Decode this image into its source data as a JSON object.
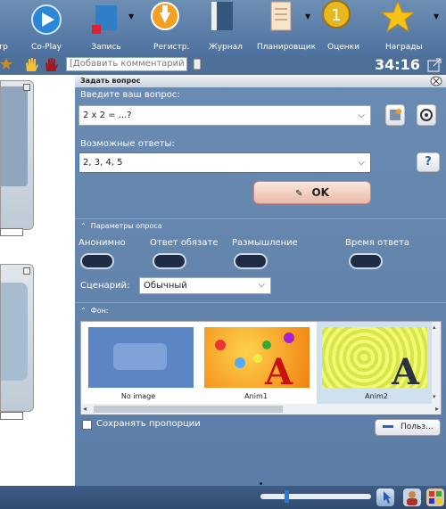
{
  "toolbar": {
    "items": [
      {
        "label": "нтр"
      },
      {
        "label": "Co-Play"
      },
      {
        "label": "Запись"
      },
      {
        "label": "Регистр."
      },
      {
        "label": "Журнал"
      },
      {
        "label": "Планировщик"
      },
      {
        "label": "Оценки"
      },
      {
        "label": "Награды"
      }
    ]
  },
  "controls": {
    "comment_placeholder": "[Добавить комментарий в жу",
    "timer": "34:16"
  },
  "dialog": {
    "title": "Задать вопрос",
    "question_label": "Введите ваш вопрос:",
    "question_value": "2 x 2 = ...?",
    "answers_label": "Возможные ответы:",
    "answers_value": "2, 3, 4, 5",
    "ok_label": "OK",
    "help_label": "?",
    "params_header": "Параметры опроса",
    "toggles": [
      {
        "label": "Анонимно"
      },
      {
        "label": "Ответ обязателен"
      },
      {
        "label": "Размышление"
      },
      {
        "label": "Время ответа"
      }
    ],
    "scenario_label": "Сценарий:",
    "scenario_value": "Обычный",
    "background_header": "Фон:",
    "backgrounds": [
      {
        "label": "No image"
      },
      {
        "label": "Anim1"
      },
      {
        "label": "Anim2"
      }
    ],
    "keep_ratio_label": "Сохранять пропорции",
    "custom_button_label": "Польз..."
  }
}
